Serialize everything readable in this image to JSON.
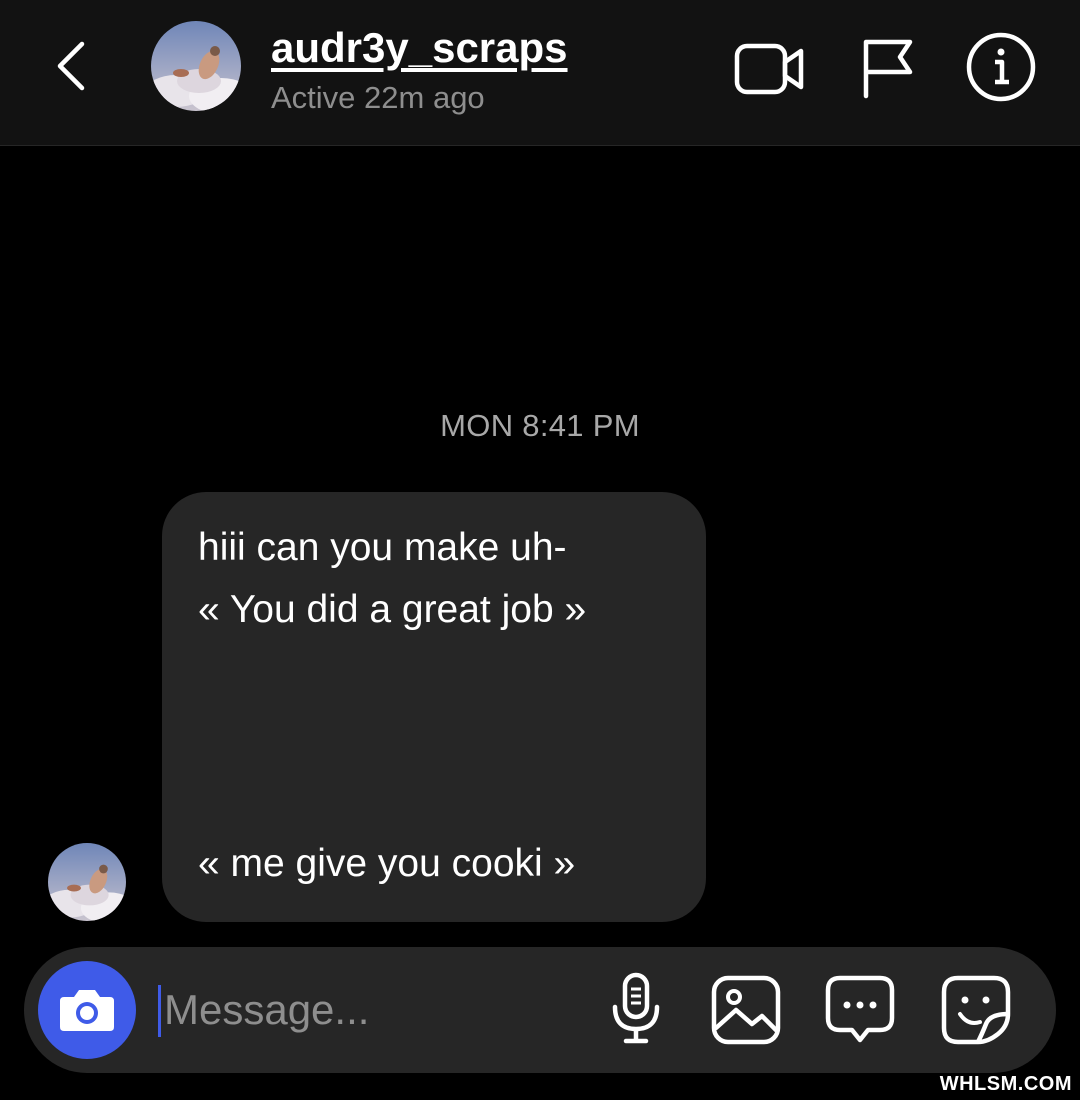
{
  "header": {
    "username": "audr3y_scraps",
    "status": "Active 22m ago",
    "icons": [
      "back-chevron-icon",
      "video-camera-icon",
      "flag-icon",
      "info-icon"
    ]
  },
  "conversation": {
    "timestamp": "MON 8:41 PM",
    "messages": [
      {
        "sender": "audr3y_scraps",
        "lines": [
          "hiii can you make uh-",
          "« You did a great job »",
          "« me give you cooki »"
        ]
      }
    ]
  },
  "composer": {
    "placeholder": "Message...",
    "icons": [
      "camera-icon",
      "microphone-icon",
      "gallery-icon",
      "chat-bubble-icon",
      "sticker-icon"
    ],
    "accent_color": "#3f5be8"
  },
  "watermark": "WHLSM.COM"
}
